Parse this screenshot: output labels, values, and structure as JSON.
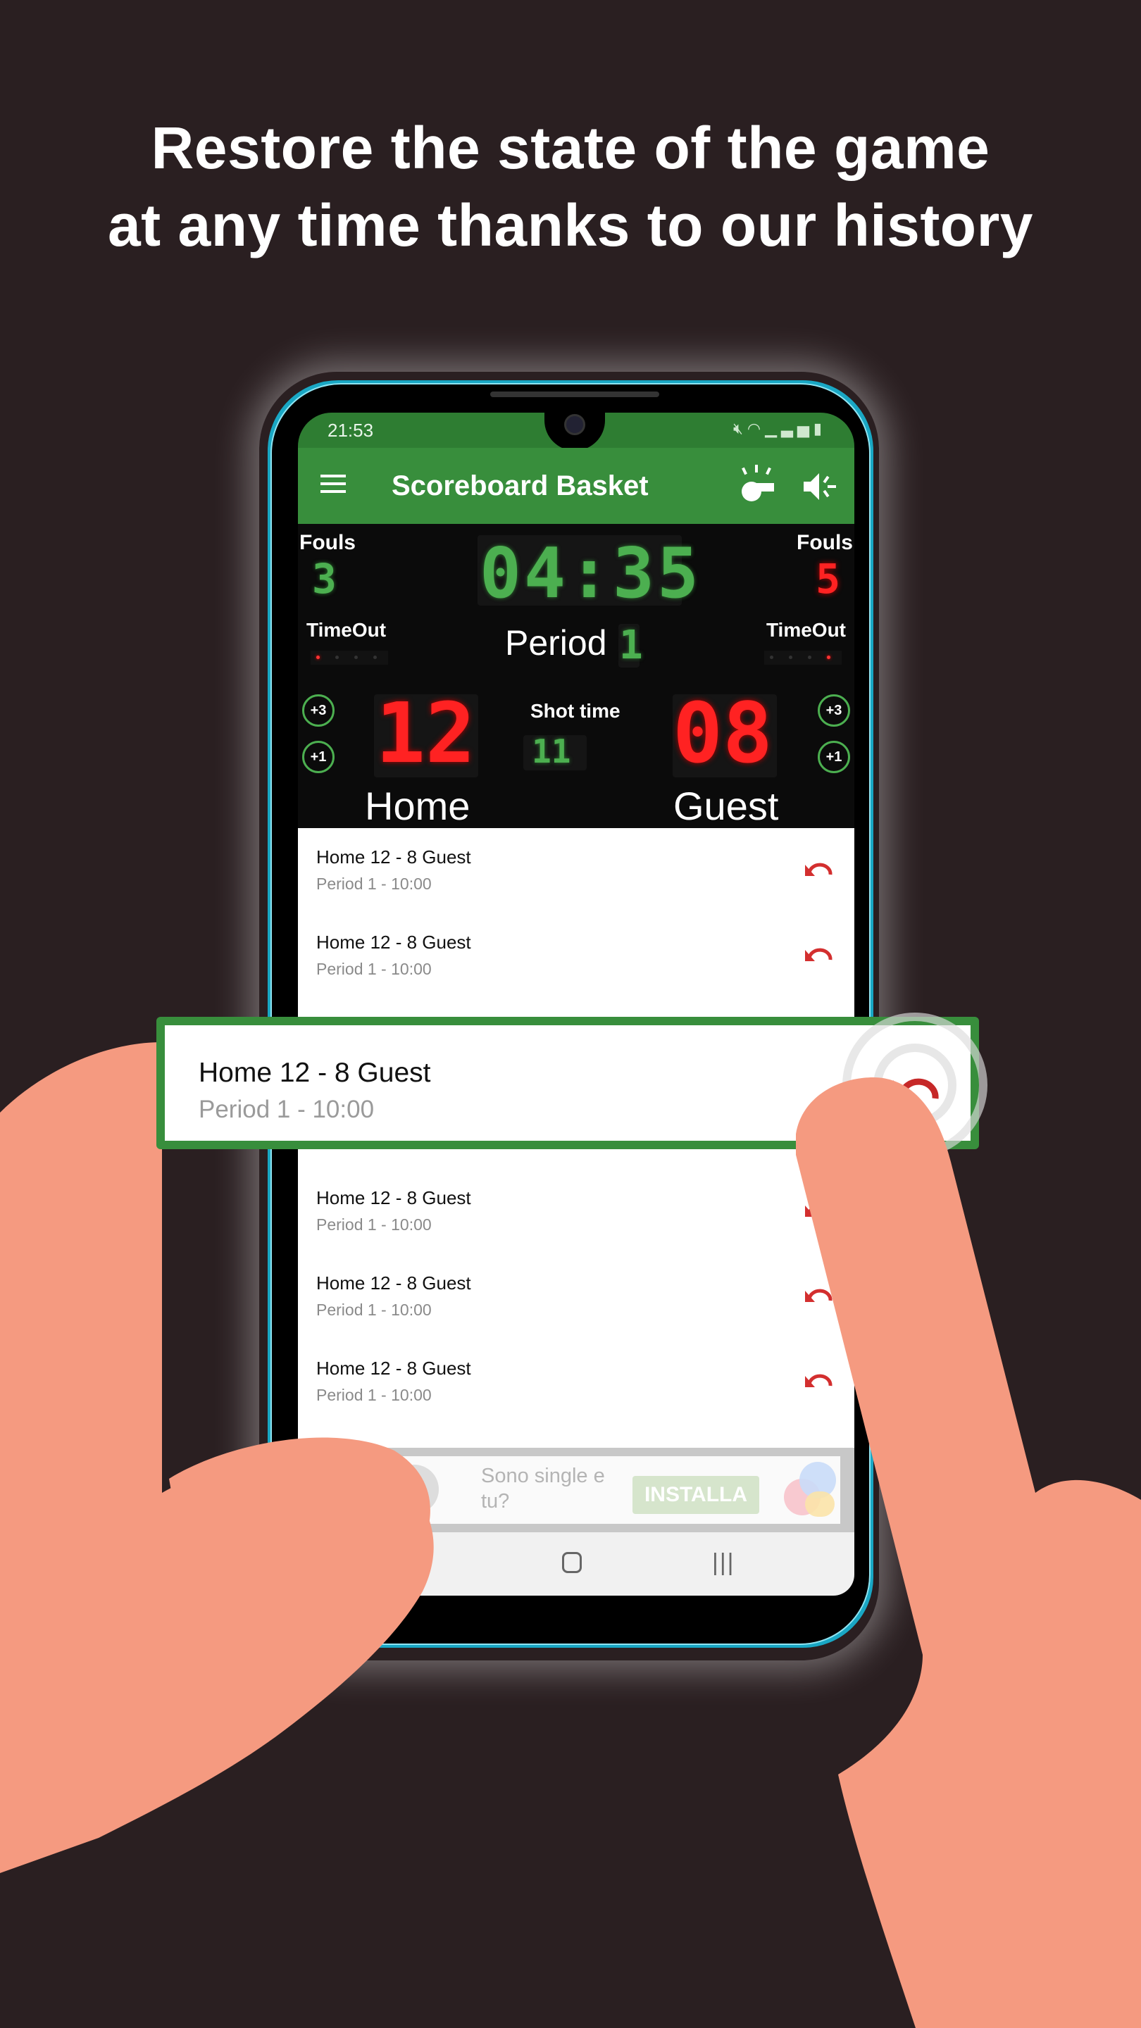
{
  "headline": {
    "line1": "Restore the state of the game",
    "line2": "at any time thanks to our history"
  },
  "status_bar": {
    "time": "21:53",
    "icons": [
      "mute-icon",
      "wifi-icon",
      "signal-icon",
      "battery-icon"
    ]
  },
  "app_bar": {
    "title": "Scoreboard Basket",
    "menu_icon": "hamburger-menu-icon",
    "actions": [
      "whistle-icon",
      "volume-icon"
    ]
  },
  "scoreboard": {
    "fouls_label": "Fouls",
    "home_fouls": "3",
    "guest_fouls": "5",
    "game_clock": "04:35",
    "timeout_label": "TimeOut",
    "home_timeouts_used": 1,
    "guest_timeouts_used": 1,
    "timeouts_max": 4,
    "period_label": "Period",
    "period": "1",
    "shot_time_label": "Shot time",
    "shot_time": "11",
    "home_score": "12",
    "guest_score": "08",
    "home_label": "Home",
    "guest_label": "Guest",
    "plus3_label": "+3",
    "plus1_label": "+1",
    "colors": {
      "led_green": "#4caf50",
      "led_red": "#ff2222"
    }
  },
  "history": {
    "items": [
      {
        "title": "Home 12 - 8 Guest",
        "subtitle": "Period 1 - 10:00"
      },
      {
        "title": "Home 12 - 8 Guest",
        "subtitle": "Period 1 - 10:00"
      },
      {
        "title": "Home 12 - 8 Guest",
        "subtitle": "Period 1 - 10:00"
      },
      {
        "title": "Home 12 - 8 Guest",
        "subtitle": "Period 1 - 10:00"
      },
      {
        "title": "Home 12 - 8 Guest",
        "subtitle": "Period 1 - 10:00"
      },
      {
        "title": "Home 12 - 8 Guest",
        "subtitle": "Period 1 - 10:00"
      },
      {
        "title": "Home 12 - 8 Guest",
        "subtitle": "Period 1 - 10:00"
      }
    ],
    "highlighted": {
      "title": "Home 12 - 8 Guest",
      "subtitle": "Period 1 - 10:00"
    },
    "action_icon": "undo-icon",
    "accent": "#c62828"
  },
  "ad": {
    "text": "Sono single e tu?",
    "button": "INSTALLA"
  },
  "nav_bar": {
    "back": "‹",
    "recent": "|||"
  },
  "colors": {
    "background": "#2a1f21",
    "brand_green": "#388e3c",
    "phone_frame": "#19a7c4",
    "hand": "#f59a80"
  }
}
